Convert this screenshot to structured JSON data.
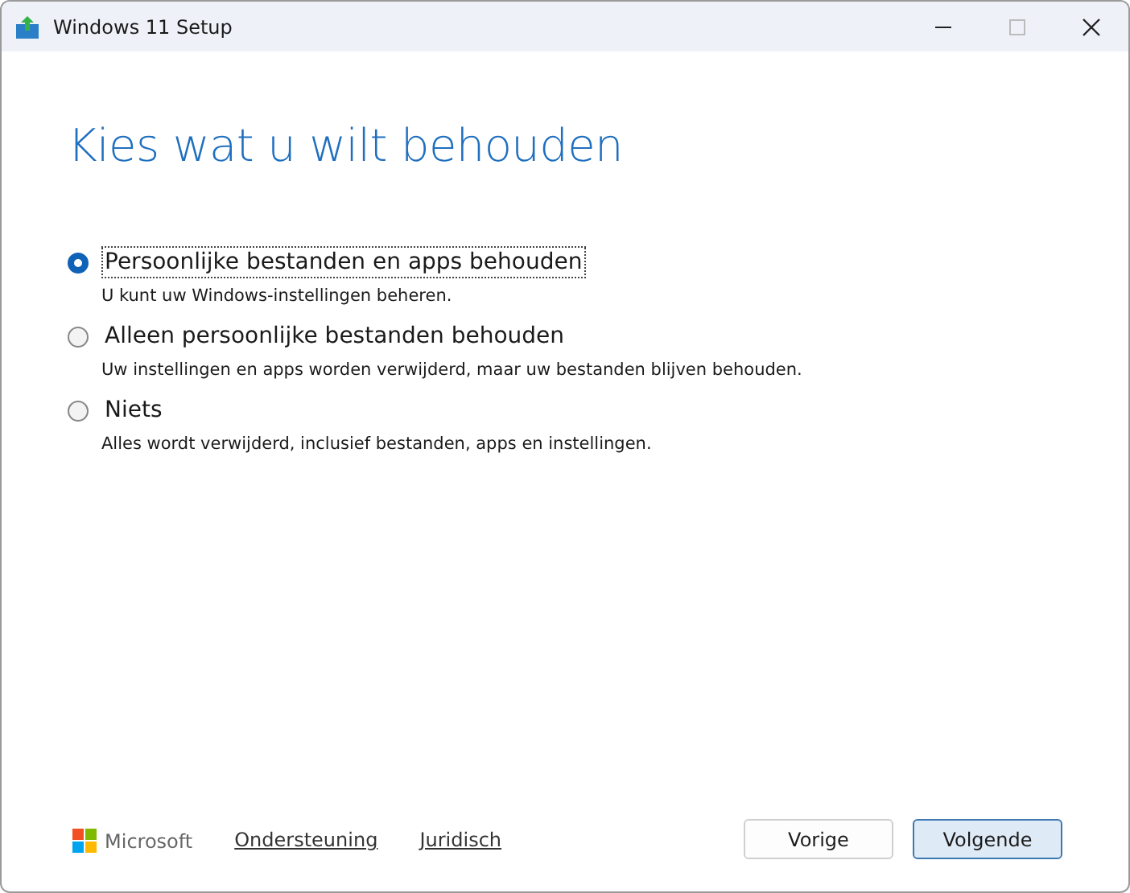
{
  "window": {
    "title": "Windows 11 Setup"
  },
  "heading": "Kies wat u wilt behouden",
  "options": [
    {
      "label": "Persoonlijke bestanden en apps behouden",
      "description": "U kunt uw Windows-instellingen beheren.",
      "selected": true
    },
    {
      "label": "Alleen persoonlijke bestanden behouden",
      "description": "Uw instellingen en apps worden verwijderd, maar uw bestanden blijven behouden.",
      "selected": false
    },
    {
      "label": "Niets",
      "description": "Alles wordt verwijderd, inclusief bestanden, apps en instellingen.",
      "selected": false
    }
  ],
  "footer": {
    "brand": "Microsoft",
    "links": [
      "Ondersteuning",
      "Juridisch"
    ]
  },
  "buttons": [
    {
      "label": "Vorige",
      "kind": "secondary"
    },
    {
      "label": "Volgende",
      "kind": "primary"
    }
  ]
}
